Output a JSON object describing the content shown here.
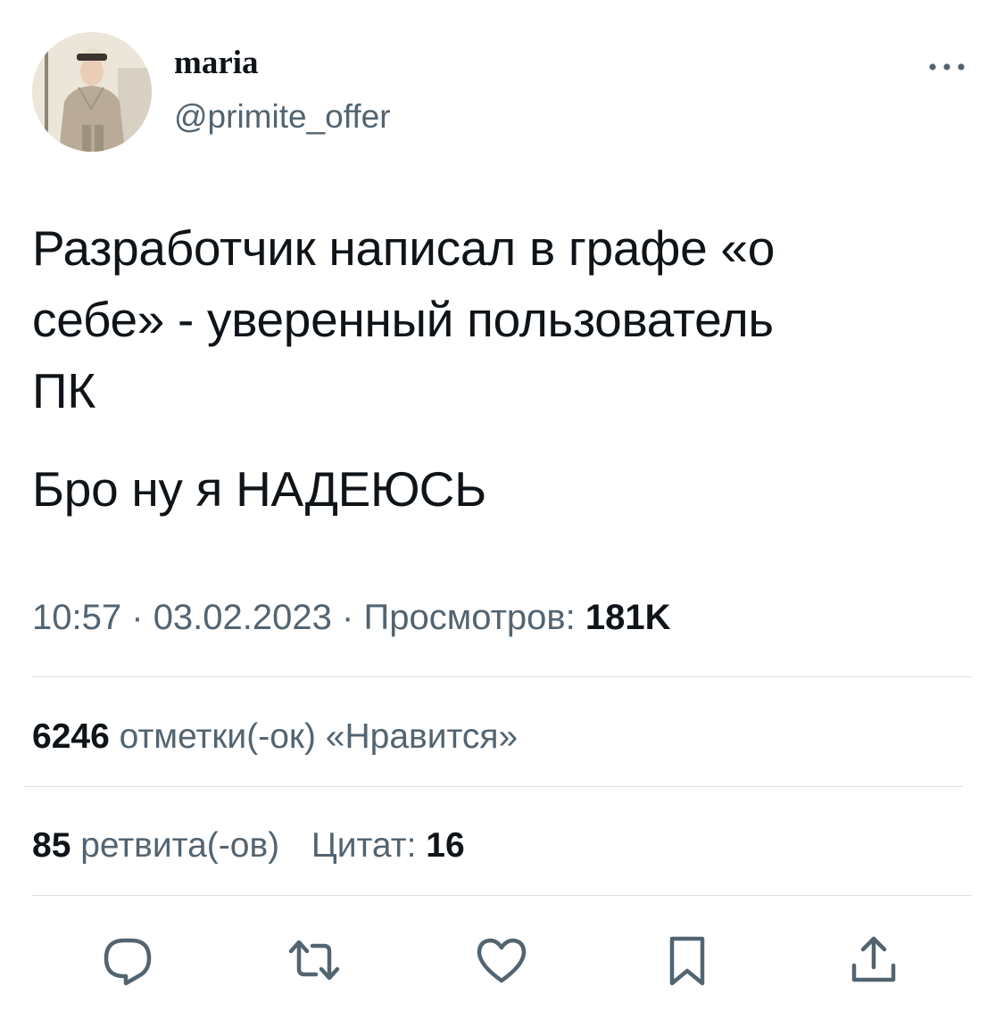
{
  "author": {
    "display_name": "maria",
    "handle": "@primite_offer",
    "avatar": "user-avatar-photo"
  },
  "tweet": {
    "text_paragraph_1": "Разработчик написал в графе «о\nсебе» - уверенный пользователь\nПК",
    "text_paragraph_2": "Бро ну я НАДЕЮСЬ"
  },
  "meta": {
    "time": "10:57",
    "separator": "·",
    "date": "03.02.2023",
    "views_label": "Просмотров:",
    "views_count": "181K"
  },
  "stats": {
    "likes_count": "6246",
    "likes_label": "отметки(-ок) «Нравится»",
    "retweets_count": "85",
    "retweets_label": "ретвита(-ов)",
    "quotes_label": "Цитат:",
    "quotes_count": "16"
  },
  "icons": {
    "more": "more-options-icon",
    "reply": "reply-icon",
    "retweet": "retweet-icon",
    "like": "like-icon",
    "bookmark": "bookmark-icon",
    "share": "share-icon"
  },
  "colors": {
    "text_primary": "#0f1419",
    "text_secondary": "#536471",
    "divider": "#dcdfe2"
  }
}
